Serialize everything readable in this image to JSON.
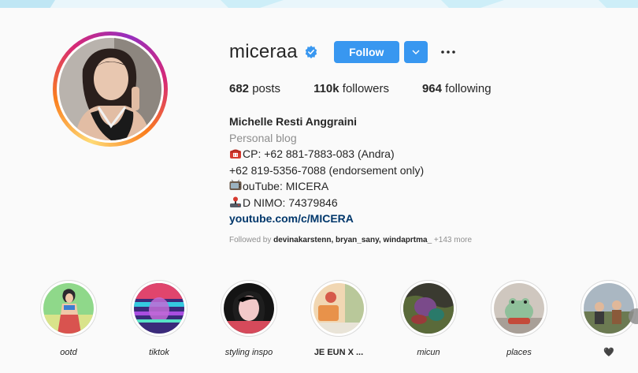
{
  "profile": {
    "username": "miceraa",
    "follow_label": "Follow",
    "more_label": "•••"
  },
  "stats": {
    "posts_count": "682",
    "posts_label": "posts",
    "followers_count": "110k",
    "followers_label": "followers",
    "following_count": "964",
    "following_label": "following"
  },
  "bio": {
    "full_name": "Michelle Resti Anggraini",
    "category": "Personal blog",
    "line_cp": "CP: +62 881-7883-083 (Andra)",
    "line_phone2": "+62 819-5356-7088 (endorsement only)",
    "line_youtube": "ouTube: MICERA",
    "line_nimo": "D NIMO: 74379846",
    "link": "youtube.com/c/MICERA",
    "icons": [
      "telephone-icon",
      "television-icon",
      "joystick-icon"
    ]
  },
  "followed_by": {
    "prefix": "Followed by ",
    "names": "devinakarstenn, bryan_sany, windaprtma_",
    "more": " +143 more"
  },
  "highlights": [
    {
      "label": "ootd"
    },
    {
      "label": "tiktok"
    },
    {
      "label": "styling inspo"
    },
    {
      "label": "JE EUN X ..."
    },
    {
      "label": "micun"
    },
    {
      "label": "places"
    },
    {
      "label": "🖤"
    }
  ],
  "colors": {
    "accent": "#3897f0",
    "link": "#00376b",
    "muted": "#8e8e8e",
    "text": "#262626"
  }
}
